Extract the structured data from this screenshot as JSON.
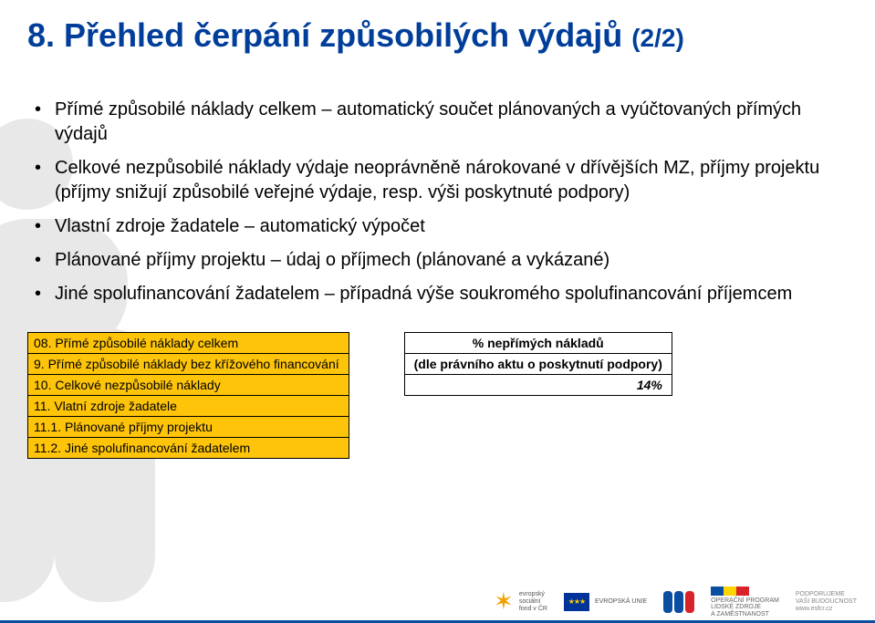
{
  "title": {
    "main": "8. Přehled čerpání způsobilých výdajů ",
    "suffix": "(2/2)"
  },
  "bullets": [
    {
      "strong": "Přímé způsobilé náklady celkem",
      "rest": " – automatický součet plánovaných a vyúčtovaných přímých výdajů"
    },
    {
      "strong": "Celkové nezpůsobilé náklady",
      "rest": " výdaje neoprávněně nárokované v dřívějších MZ, příjmy projektu (příjmy snižují způsobilé veřejné výdaje, resp. výši poskytnuté podpory)"
    },
    {
      "strong": "Vlastní zdroje žadatele",
      "rest": " – automatický výpočet"
    },
    {
      "strong": "Plánované příjmy projektu",
      "rest": " – údaj o příjmech (plánované a vykázané)"
    },
    {
      "strong": "Jiné spolufinancování žadatelem",
      "rest": " – případná výše soukromého spolufinancování příjemcem"
    }
  ],
  "leftTable": [
    "08. Přímé způsobilé náklady celkem",
    "9. Přímé způsobilé náklady bez křížového financování",
    "10. Celkové nezpůsobilé náklady",
    "11. Vlatní zdroje žadatele",
    "11.1. Plánované příjmy projektu",
    "11.2. Jiné spolufinancování žadatelem"
  ],
  "rightTable": {
    "head": "% nepřímých nákladů",
    "sub": "(dle právního aktu o poskytnutí podpory)",
    "value": "14%"
  },
  "footer": {
    "esf": "evropský\nsociální\nfond v ČR",
    "eu": "EVROPSKÁ UNIE",
    "oplzz": "OPERAČNÍ PROGRAM\nLIDSKÉ ZDROJE\nA ZAMĚSTNANOST",
    "support": "PODPORUJEME\nVAŠI BUDOUCNOST\nwww.esfcr.cz"
  }
}
